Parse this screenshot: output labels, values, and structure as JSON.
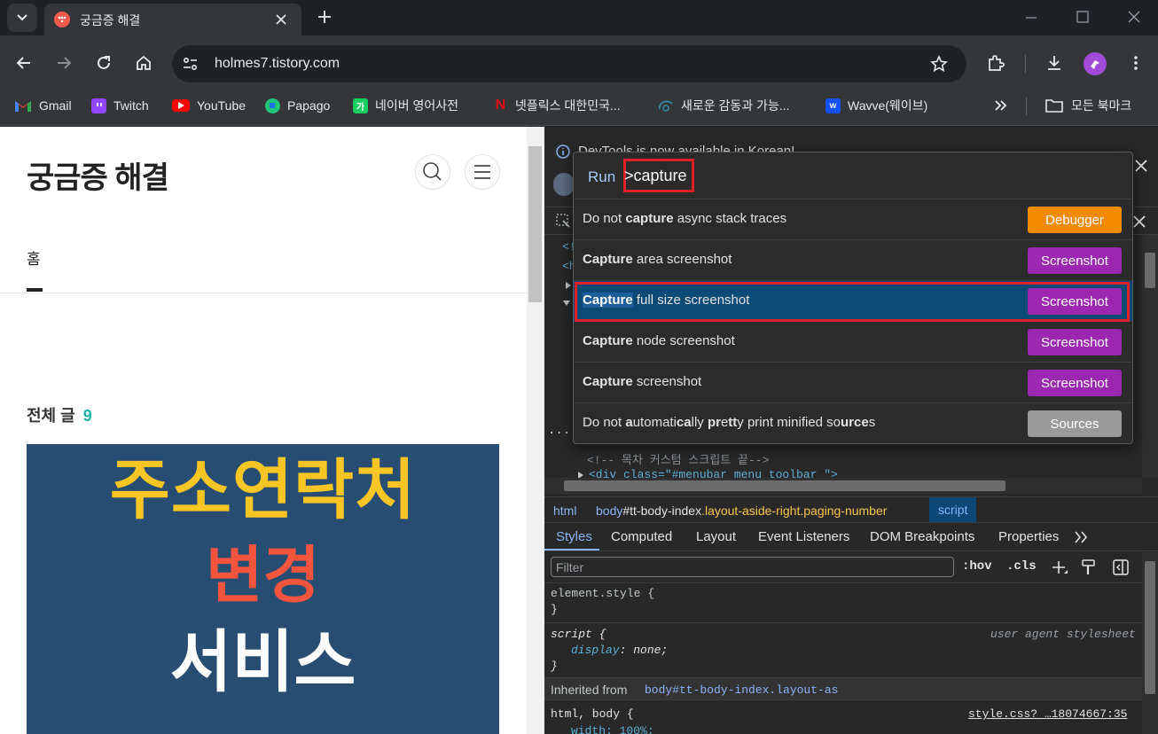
{
  "browser": {
    "tab_title": "궁금증 해결",
    "url": "holmes7.tistory.com",
    "bookmarks": [
      {
        "label": "Gmail",
        "icon": "gmail-icon",
        "color": "#ea4335"
      },
      {
        "label": "Twitch",
        "icon": "twitch-icon",
        "color": "#9146ff"
      },
      {
        "label": "YouTube",
        "icon": "youtube-icon",
        "color": "#ff0000"
      },
      {
        "label": "Papago",
        "icon": "papago-icon",
        "color": "#1fc37a"
      },
      {
        "label": "네이버 영어사전",
        "icon": "naver-dict-icon",
        "color": "#19ce60",
        "glyph": "가"
      },
      {
        "label": "넷플릭스 대한민국...",
        "icon": "netflix-icon",
        "color": "#e50914",
        "glyph": "N"
      },
      {
        "label": "새로운 감동과 가능...",
        "icon": "disney-icon",
        "color": "#2f5b7a"
      },
      {
        "label": "Wavve(웨이브)",
        "icon": "wavve-icon",
        "color": "#1351f9",
        "glyph": "w"
      }
    ],
    "all_bookmarks_label": "모든 북마크"
  },
  "page": {
    "blog_title": "궁금증 해결",
    "nav_home": "홈",
    "posts_label": "전체 글",
    "posts_count": "9",
    "banner": {
      "line1": "주소연락처",
      "line2": "변경",
      "line3": "서비스"
    }
  },
  "devtools": {
    "notice": "DevTools is now available in Korean!",
    "palette": {
      "prefix": "Run",
      "query": ">capture",
      "items": [
        {
          "pre": "Do not ",
          "bold": "capture",
          "post": " async stack traces",
          "button": "Debugger",
          "btn_color": "#f28b00"
        },
        {
          "pre": "",
          "bold": "Capture",
          "post": " area screenshot",
          "button": "Screenshot",
          "btn_color": "#9c27b0"
        },
        {
          "pre": "",
          "bold": "Capture",
          "post": " full size screenshot",
          "button": "Screenshot",
          "btn_color": "#9c27b0"
        },
        {
          "pre": "",
          "bold": "Capture",
          "post": " node screenshot",
          "button": "Screenshot",
          "btn_color": "#9c27b0"
        },
        {
          "pre": "",
          "bold": "Capture",
          "post": " screenshot",
          "button": "Screenshot",
          "btn_color": "#9c27b0"
        },
        {
          "button": "Sources",
          "btn_color": "#9a9a9a"
        }
      ],
      "last_item_parts": [
        "Do not ",
        "a",
        "utomati",
        "ca",
        "lly ",
        "pr",
        "e",
        "tt",
        "y print minified so",
        "urce",
        "s"
      ]
    },
    "comment_line": "<!-- 목차 커스텀 스크립트 끝-->",
    "div_line": "<div class=\"#menubar menu_toolbar \">",
    "breadcrumb": {
      "html": "html",
      "body_tag": "body",
      "body_id": "#tt-body-index",
      "body_class": ".layout-aside-right.paging-number",
      "script": "script"
    },
    "tabs": [
      "Styles",
      "Computed",
      "Layout",
      "Event Listeners",
      "DOM Breakpoints",
      "Properties"
    ],
    "filter_placeholder": "Filter",
    "hov": ":hov",
    "cls": ".cls",
    "styles": {
      "element_style": "element.style {",
      "close": "}",
      "script_sel": "script {",
      "ua": "user agent stylesheet",
      "prop": "display",
      "val": "none;",
      "inherited_label": "Inherited from",
      "inherited_link": "body#tt-body-index.layout-as",
      "html_body": "html, body {",
      "source": "style.css?_…18074667:35",
      "width_prop": "width: 100%;"
    }
  }
}
